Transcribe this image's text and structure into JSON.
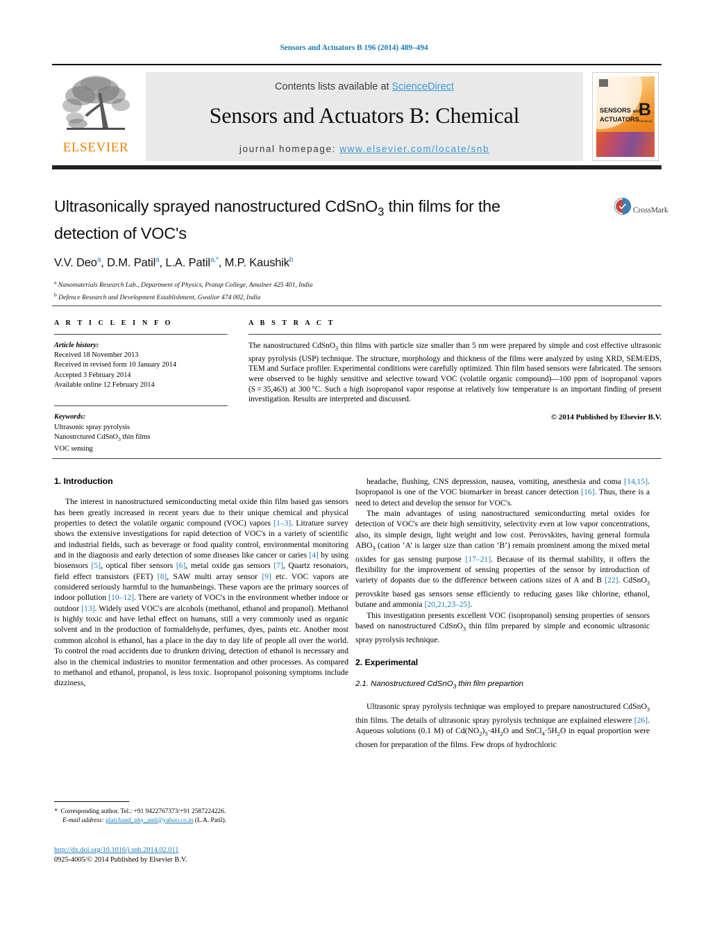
{
  "running_head": "Sensors and Actuators B 196 (2014) 489–494",
  "masthead": {
    "contents_prefix": "Contents lists available at ",
    "sciencedirect": "ScienceDirect",
    "journal_title": "Sensors and Actuators B: Chemical",
    "homepage_prefix": "journal homepage: ",
    "homepage_url": "www.elsevier.com/locate/snb",
    "publisher_logo_text": "ELSEVIER",
    "cover": {
      "line1": "SENSORS",
      "and": "and",
      "line2": "ACTUATORS",
      "series": "B",
      "series_sub": "Chemical"
    },
    "accent_orange": "#f08000",
    "accent_blue": "#3a9ad9"
  },
  "crossmark": {
    "label": "CrossMark"
  },
  "article": {
    "title": "Ultrasonically sprayed nanostructured CdSnO3 thin films for the detection of VOC's",
    "title_html": "Ultrasonically sprayed nanostructured CdSnO<sub>3</sub> thin films for the detection of VOC's",
    "authors_html": "V.V. Deo<sup>a</sup>, D.M. Patil<sup>a</sup>, L.A. Patil<sup>a,*</sup>, M.P. Kaushik<sup>b</sup>",
    "affiliations": [
      {
        "marker": "a",
        "text": "Nanomaterials Research Lab., Department of Physics, Pratap College, Amalner 425 401, India"
      },
      {
        "marker": "b",
        "text": "Defence Research and Development Establishment, Gwalior 474 002, India"
      }
    ]
  },
  "article_info": {
    "heading": "A R T I C L E   I N F O",
    "history_label": "Article history:",
    "history": [
      "Received 18 November 2013",
      "Received in revised form 10 January 2014",
      "Accepted 3 February 2014",
      "Available online 12 February 2014"
    ],
    "keywords_label": "Keywords:",
    "keywords_html": [
      "Ultrasonic spray pyrolysis",
      "Nanostrctured CdSnO<sub>3</sub> thin films",
      "VOC sensing"
    ]
  },
  "abstract": {
    "heading": "A B S T R A C T",
    "text_html": "The nanostructured CdSnO<sub>3</sub> thin films with particle size smaller than 5 nm were prepared by simple and cost effective ultrasonic spray pyrolysis (USP) technique. The structure, morphology and thickness of the films were analyzed by using XRD, SEM/EDS, TEM and Surface profiler. Experimental conditions were carefully optimized. Thin film based sensors were fabricated. The sensors were observed to be highly sensitive and selective toward VOC (volatile organic compound)&mdash;100 ppm of isopropanol vapors (S&#8239;=&#8239;35,463) at 300&#8239;&deg;C. Such a high isopropanol vapor response at relatively low temperature is an important finding of present investigation. Results are interpreted and discussed.",
    "copyright": "© 2014 Published by Elsevier B.V."
  },
  "body": {
    "left": {
      "section_heading": "1.  Introduction",
      "paragraph_1_html": "The interest in nanostructured semiconducting metal oxide thin film based gas sensors has been greatly increased in recent years due to their unique chemical and physical properties to detect the volatile organic compound (VOC) vapors <span class=\"cite\">[1&ndash;3]</span>. Litrature survey shows the extensive investigations for rapid detection of VOC's in a variety of scientific and industrial fields, such as beverage or food quality control, environmental monitoring and in the diagnosis and early detection of some diseases like cancer or caries <span class=\"cite\">[4]</span> by using biosensors <span class=\"cite\">[5]</span>, optical fiber sensors <span class=\"cite\">[6]</span>, metal oxide gas sensors <span class=\"cite\">[7]</span>, Quartz resonators, field effect transistors (FET) <span class=\"cite\">[8]</span>, SAW multi array sensor <span class=\"cite\">[9]</span> etc. VOC vapors are considered seriously harmful to the humanbeings. These vapors are the primary sources of indoor pollution <span class=\"cite\">[10&ndash;12]</span>. There are variety of VOC's in the environment whether indoor or outdoor <span class=\"cite\">[13]</span>. Widely used VOC's are alcohols (methanol, ethanol and propanol). Methanol is highly toxic and have lethal effect on humans, still a very commonly used as organic solvent and in the production of formaldehyde, perfumes, dyes, paints etc. Another most common alcohol is ethanol, has a place in the day to day life of people all over the world. To control the road accidents due to drunken driving, detection of ethanol is necessary and also in the chemical industries to monitor fermentation and other processes. As compared to methanol and ethanol, propanol, is less toxic. Isopropanol poisoning symptoms include dizziness,"
    },
    "right": {
      "paragraph_1_html": "headache, flushing, CNS depression, nausea, vomiting, anesthesia and coma <span class=\"cite\">[14,15]</span>. Isopropanol is one of the VOC biomarker in breast cancer detection <span class=\"cite\">[16]</span>. Thus, there is a need to detect and develop the sensor for VOC's.",
      "paragraph_2_html": "The main advantages of using nanostructured semiconducting metal oxides for detection of VOC's are their high sensitivity, selectivity even at low vapor concentrations, also, its simple design, light weight and low cost. Perovskites, having general formula ABO<sub>3</sub> (cation &lsquo;A&rsquo; is larger size than cation &lsquo;B&rsquo;) remain prominent among the mixed metal oxides for gas sensing purpose <span class=\"cite\">[17&ndash;21]</span>. Because of its thermal stability, it offers the flexibility for the improvement of sensing properties of the sensor by introduction of variety of dopants due to the difference between cations sizes of A and B <span class=\"cite\">[22]</span>. CdSnO<sub>3</sub> perovskite based gas sensors sense efficiently to reducing gases like chlorine, ethanol, butane and ammonia <span class=\"cite\">[20,21,23&ndash;25]</span>.",
      "paragraph_3_html": "This investigation presents excellent VOC (isopropanol) sensing properties of sensors based on nanostructured CdSnO<sub>3</sub> thin film prepared by simple and economic ultrasonic spray pyrolysis technique.",
      "section_heading": "2.  Experimental",
      "subsection_heading_html": "2.1.  Nanostructured CdSnO<sub>3</sub> thin film prepartion",
      "paragraph_4_html": "Ultrasonic spray pyrolysis technique was employed to prepare nanostructured CdSnO<sub>3</sub> thin films. The details of ultrasonic spray pyrolysis technique are explained eleswere <span class=\"cite\">[26]</span>. Aqueous solutions (0.1 M) of Cd(NO<sub>2</sub>)<sub>3</sub>&#183;4H<sub>2</sub>O and SnCl<sub>4</sub>&#183;5H<sub>2</sub>O in equal proportion were chosen for preparation of the films. Few drops of hydrochloric"
    }
  },
  "footer": {
    "corresponding_html": "<span class=\"ital\">*</span>&nbsp; Corresponding author. Tel.: +91 9422767373/+91 2587224226.",
    "email_label": "E-mail address:",
    "email": "plalchand_phy_aml@yahoo.co.in",
    "email_suffix": "(L.A. Patil).",
    "doi": "http://dx.doi.org/10.1016/j.snb.2014.02.011",
    "issn_line": "0925-4005/© 2014 Published by Elsevier B.V."
  }
}
